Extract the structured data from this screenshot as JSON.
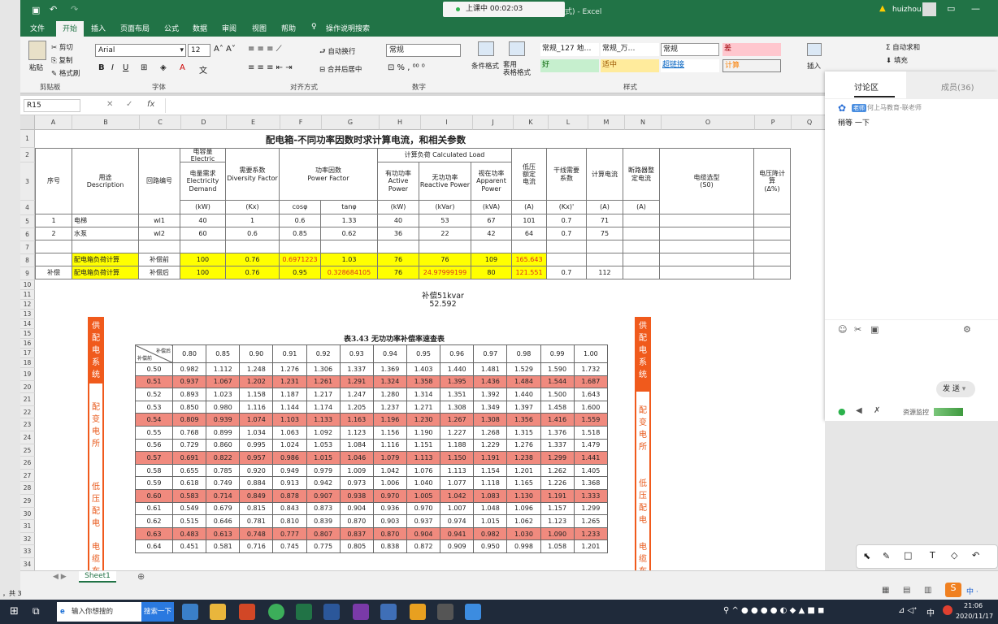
{
  "titlebar": {
    "recording": "上课中 00:02:03",
    "title_suffix": "式)  -  Excel",
    "user": "huizhou",
    "warning_icon": "warning-icon"
  },
  "tabs": [
    "文件",
    "开始",
    "插入",
    "页面布局",
    "公式",
    "数据",
    "审阅",
    "视图",
    "帮助",
    "操作说明搜索"
  ],
  "active_tab": "开始",
  "ribbon": {
    "paste": "粘贴",
    "cut": "剪切",
    "copy": "复制",
    "format_painter": "格式刷",
    "clipboard": "剪贴板",
    "font_name": "Arial",
    "font_size": "12",
    "font_group": "字体",
    "wrap": "自动换行",
    "merge": "合并后居中",
    "align_group": "对齐方式",
    "number_format": "常规",
    "number_group": "数字",
    "cond_format": "条件格式",
    "table_format": "套用\n表格格式",
    "styles": [
      "常规_127 地…",
      "常规_万…",
      "常规",
      "差",
      "好",
      "适中",
      "超链接",
      "计算"
    ],
    "styles_group": "样式",
    "insert": "插入",
    "autosum": "自动求和",
    "fill": "填充"
  },
  "formula": {
    "namebox": "R15",
    "fx": "fx"
  },
  "columns": [
    "A",
    "B",
    "C",
    "D",
    "E",
    "F",
    "G",
    "H",
    "I",
    "J",
    "K",
    "L",
    "M",
    "N",
    "O",
    "P",
    "Q"
  ],
  "rows": [
    "1",
    "2",
    "3",
    "4",
    "5",
    "6",
    "7",
    "8",
    "9",
    "10",
    "11",
    "12",
    "13",
    "14",
    "15",
    "16",
    "17",
    "18",
    "19",
    "20",
    "21",
    "22",
    "23",
    "24",
    "25",
    "26",
    "27",
    "28",
    "29",
    "30",
    "31",
    "32",
    "33",
    "34",
    "35",
    "36",
    "37",
    "38"
  ],
  "sheet": {
    "title": "配电箱-不同功率因数时求计算电流，和相关参数",
    "h_seq": "序号",
    "h_desc": "用途\nDescription",
    "h_circuit": "回路编号",
    "h_cap": "电容量 Electric",
    "h_demand": "电量需求\nElectricity\nDemand",
    "h_div": "需要系数\nDiversity Factor",
    "h_pf": "功率因数\nPower Factor",
    "h_calc": "计算负荷 Calculated Load",
    "h_active": "有功功率\nActive\nPower",
    "h_reactive": "无功功率\nReactive Power",
    "h_apparent": "视在功率\nApparent\nPower",
    "h_lowv": "低压\n额定\n电流",
    "h_trunk": "干线需要\n系数",
    "h_calc_i": "计算电流",
    "h_breaker": "断路器整\n定电流",
    "h_cable": "电缆选型\n(S0)",
    "h_vdrop": "电压降计\n算\n(Δ%)",
    "u_kw": "(kW)",
    "u_kx": "(Kx)",
    "u_cos": "cosφ",
    "u_tan": "tanφ",
    "u_kw2": "(kW)",
    "u_kvar": "(kVar)",
    "u_kva": "(kVA)",
    "u_a": "(A)",
    "u_kx2": "(Kx)'",
    "u_a2": "(A)",
    "u_a3": "(A)",
    "r5": [
      "1",
      "电梯",
      "wl1",
      "40",
      "1",
      "0.6",
      "1.33",
      "40",
      "53",
      "67",
      "101",
      "0.7",
      "71"
    ],
    "r6": [
      "2",
      "水泵",
      "wl2",
      "60",
      "0.6",
      "0.85",
      "0.62",
      "36",
      "22",
      "42",
      "64",
      "0.7",
      "75"
    ],
    "r8": [
      "",
      "配电箱负荷计算",
      "补偿前",
      "100",
      "0.76",
      "0.6971223",
      "1.03",
      "76",
      "76",
      "109",
      "165.643",
      "",
      ""
    ],
    "r9": [
      "补偿",
      "配电箱负荷计算",
      "补偿后",
      "100",
      "0.76",
      "0.95",
      "0.328684105",
      "76",
      "24.97999199",
      "80",
      "121.551",
      "0.7",
      "112"
    ],
    "note1": "补偿51kvar",
    "note2": "52.592"
  },
  "lookup": {
    "caption": "表3.43  无功功率补偿率速查表",
    "corner_top": "补偿后",
    "corner_bottom": "补偿前",
    "header": [
      "0.80",
      "0.85",
      "0.90",
      "0.91",
      "0.92",
      "0.93",
      "0.94",
      "0.95",
      "0.96",
      "0.97",
      "0.98",
      "0.99",
      "1.00"
    ],
    "rows": [
      [
        "0.50",
        "0.982",
        "1.112",
        "1.248",
        "1.276",
        "1.306",
        "1.337",
        "1.369",
        "1.403",
        "1.440",
        "1.481",
        "1.529",
        "1.590",
        "1.732"
      ],
      [
        "0.51",
        "0.937",
        "1.067",
        "1.202",
        "1.231",
        "1.261",
        "1.291",
        "1.324",
        "1.358",
        "1.395",
        "1.436",
        "1.484",
        "1.544",
        "1.687"
      ],
      [
        "0.52",
        "0.893",
        "1.023",
        "1.158",
        "1.187",
        "1.217",
        "1.247",
        "1.280",
        "1.314",
        "1.351",
        "1.392",
        "1.440",
        "1.500",
        "1.643"
      ],
      [
        "0.53",
        "0.850",
        "0.980",
        "1.116",
        "1.144",
        "1.174",
        "1.205",
        "1.237",
        "1.271",
        "1.308",
        "1.349",
        "1.397",
        "1.458",
        "1.600"
      ],
      [
        "0.54",
        "0.809",
        "0.939",
        "1.074",
        "1.103",
        "1.133",
        "1.163",
        "1.196",
        "1.230",
        "1.267",
        "1.308",
        "1.356",
        "1.416",
        "1.559"
      ],
      [
        "0.55",
        "0.768",
        "0.899",
        "1.034",
        "1.063",
        "1.092",
        "1.123",
        "1.156",
        "1.190",
        "1.227",
        "1.268",
        "1.315",
        "1.376",
        "1.518"
      ],
      [
        "0.56",
        "0.729",
        "0.860",
        "0.995",
        "1.024",
        "1.053",
        "1.084",
        "1.116",
        "1.151",
        "1.188",
        "1.229",
        "1.276",
        "1.337",
        "1.479"
      ],
      [
        "0.57",
        "0.691",
        "0.822",
        "0.957",
        "0.986",
        "1.015",
        "1.046",
        "1.079",
        "1.113",
        "1.150",
        "1.191",
        "1.238",
        "1.299",
        "1.441"
      ],
      [
        "0.58",
        "0.655",
        "0.785",
        "0.920",
        "0.949",
        "0.979",
        "1.009",
        "1.042",
        "1.076",
        "1.113",
        "1.154",
        "1.201",
        "1.262",
        "1.405"
      ],
      [
        "0.59",
        "0.618",
        "0.749",
        "0.884",
        "0.913",
        "0.942",
        "0.973",
        "1.006",
        "1.040",
        "1.077",
        "1.118",
        "1.165",
        "1.226",
        "1.368"
      ],
      [
        "0.60",
        "0.583",
        "0.714",
        "0.849",
        "0.878",
        "0.907",
        "0.938",
        "0.970",
        "1.005",
        "1.042",
        "1.083",
        "1.130",
        "1.191",
        "1.333"
      ],
      [
        "0.61",
        "0.549",
        "0.679",
        "0.815",
        "0.843",
        "0.873",
        "0.904",
        "0.936",
        "0.970",
        "1.007",
        "1.048",
        "1.096",
        "1.157",
        "1.299"
      ],
      [
        "0.62",
        "0.515",
        "0.646",
        "0.781",
        "0.810",
        "0.839",
        "0.870",
        "0.903",
        "0.937",
        "0.974",
        "1.015",
        "1.062",
        "1.123",
        "1.265"
      ],
      [
        "0.63",
        "0.483",
        "0.613",
        "0.748",
        "0.777",
        "0.807",
        "0.837",
        "0.870",
        "0.904",
        "0.941",
        "0.982",
        "1.030",
        "1.090",
        "1.233"
      ],
      [
        "0.64",
        "0.451",
        "0.581",
        "0.716",
        "0.745",
        "0.775",
        "0.805",
        "0.838",
        "0.872",
        "0.909",
        "0.950",
        "0.998",
        "1.058",
        "1.201"
      ]
    ],
    "red_rows": [
      1,
      4,
      7,
      10,
      13
    ],
    "left_banners": [
      "供配电系统",
      "配变电所",
      "低压配电",
      "电缆布"
    ],
    "right_banners": [
      "供配电系统",
      "配变电所",
      "低压配电",
      "电缆布"
    ]
  },
  "sidebar": {
    "tab_discuss": "讨论区",
    "tab_members": "成员(36)",
    "msg_sender": "何上马教育-联老师",
    "msg_badge": "老师",
    "msg_text": "稍等 一下",
    "send": "发 送",
    "monitor": "资源监控"
  },
  "status": {
    "sheet_tab": "Sheet1",
    "left_text": "，共 3"
  },
  "taskbar": {
    "search": "输入你想搜的",
    "search_btn": "搜索一下",
    "time": "21:06",
    "date": "2020/11/17",
    "ime": "中"
  }
}
